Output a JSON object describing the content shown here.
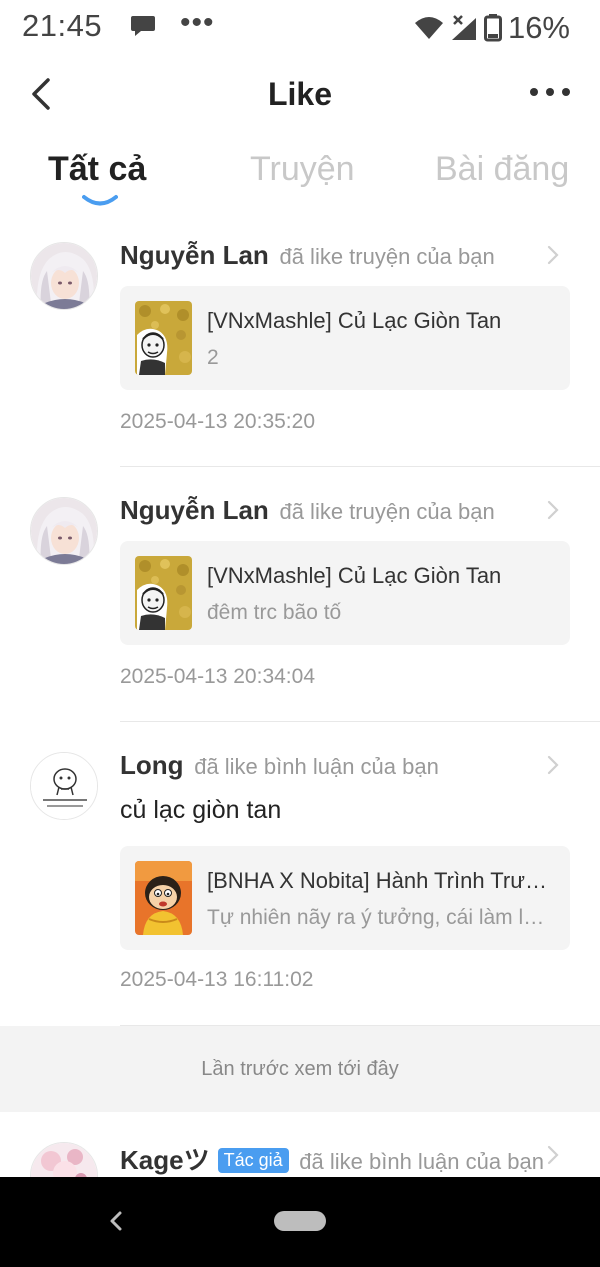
{
  "status_bar": {
    "time": "21:45",
    "dots": "•••",
    "battery": "16%",
    "icons": [
      "message-icon",
      "wifi-icon",
      "signal-icon",
      "battery-icon"
    ]
  },
  "header": {
    "title": "Like",
    "back_icon": "back-arrow-icon",
    "more_icon": "more-options-icon"
  },
  "tabs": [
    {
      "label": "Tất cả",
      "active": true
    },
    {
      "label": "Truyện",
      "active": false
    },
    {
      "label": "Bài đăng",
      "active": false
    }
  ],
  "feed": [
    {
      "username": "Nguyễn Lan",
      "action": "đã like truyện của bạn",
      "card_title": "[VNxMashle] Củ Lạc Giòn Tan",
      "card_sub": "2",
      "timestamp": "2025-04-13 20:35:20"
    },
    {
      "username": "Nguyễn Lan",
      "action": "đã like truyện của bạn",
      "card_title": "[VNxMashle] Củ Lạc Giòn Tan",
      "card_sub": "đêm trc bão tố",
      "timestamp": "2025-04-13 20:34:04"
    },
    {
      "username": "Long",
      "action": "đã like bình luận của bạn",
      "comment": "củ lạc giòn tan",
      "card_title": "[BNHA X Nobita] Hành Trình Trưởng Thành",
      "card_sub": "Tự nhiên nãy ra ý tưởng, cái làm luôn",
      "timestamp": "2025-04-13 16:11:02"
    }
  ],
  "last_seen": "Lần trước xem tới đây",
  "partial_item": {
    "username": "Kageツ",
    "badge": "Tác giả",
    "action": "đã like bình luận của bạn"
  },
  "colors": {
    "accent": "#4a9df0",
    "tab_inactive": "#c8c8c8",
    "muted_text": "#999999",
    "card_bg": "#f4f4f4"
  }
}
